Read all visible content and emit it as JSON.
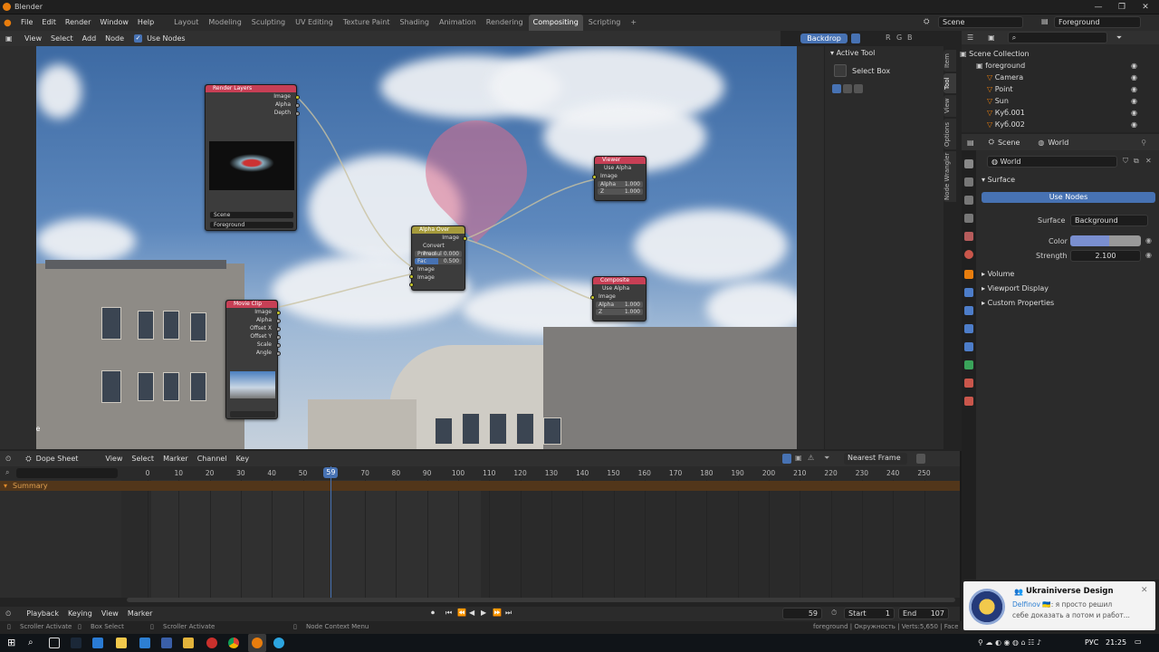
{
  "app": {
    "title": "Blender"
  },
  "menus": [
    "File",
    "Edit",
    "Render",
    "Window",
    "Help"
  ],
  "workspaces": [
    "Layout",
    "Modeling",
    "Sculpting",
    "UV Editing",
    "Texture Paint",
    "Shading",
    "Animation",
    "Rendering",
    "Compositing",
    "Scripting"
  ],
  "active_workspace": "Compositing",
  "scene_field": "Scene",
  "view_layer_field": "Foreground",
  "node_header": {
    "items": [
      "View",
      "Select",
      "Add",
      "Node"
    ],
    "use_nodes": "Use Nodes",
    "backdrop": "Backdrop",
    "channels": [
      "R",
      "G",
      "B"
    ]
  },
  "viewport": {
    "scene_label": "Scene"
  },
  "nodes": {
    "render_layers": {
      "title": "Render Layers",
      "outputs": [
        "Image",
        "Alpha",
        "Depth"
      ],
      "scene": "Scene",
      "layer": "Foreground"
    },
    "viewer": {
      "title": "Viewer",
      "use_alpha": "Use Alpha",
      "input": "Image",
      "alpha_label": "Alpha",
      "alpha_val": "1.000",
      "z_label": "Z",
      "z_val": "1.000"
    },
    "alpha_over": {
      "title": "Alpha Over",
      "output": "Image",
      "convert": "Convert Premul",
      "premul_label": "Premul",
      "premul_val": "0.000",
      "fac_label": "Fac",
      "fac_val": "0.500",
      "in1": "Image",
      "in2": "Image"
    },
    "composite": {
      "title": "Composite",
      "use_alpha": "Use Alpha",
      "input": "Image",
      "alpha_label": "Alpha",
      "alpha_val": "1.000",
      "z_label": "Z",
      "z_val": "1.000"
    },
    "movie_clip": {
      "title": "Movie Clip",
      "outputs": [
        "Image",
        "Alpha",
        "Offset X",
        "Offset Y",
        "Scale",
        "Angle"
      ]
    }
  },
  "tool_panel": {
    "title": "Active Tool",
    "tool": "Select Box"
  },
  "side_tabs": [
    "Item",
    "Tool",
    "View",
    "Options",
    "Node Wrangler"
  ],
  "outliner": {
    "root": "Scene Collection",
    "items": [
      {
        "name": "foreground",
        "depth": 1
      },
      {
        "name": "Camera",
        "depth": 2
      },
      {
        "name": "Point",
        "depth": 2
      },
      {
        "name": "Sun",
        "depth": 2
      },
      {
        "name": "Куб.001",
        "depth": 2
      },
      {
        "name": "Куб.002",
        "depth": 2
      }
    ]
  },
  "properties": {
    "breadcrumb_scene": "Scene",
    "breadcrumb_world": "World",
    "world_name": "World",
    "surface_section": "Surface",
    "use_nodes_btn": "Use Nodes",
    "surface_label": "Surface",
    "surface_value": "Background",
    "color_label": "Color",
    "strength_label": "Strength",
    "strength_value": "2.100",
    "collapsed": [
      "Volume",
      "Viewport Display",
      "Custom Properties"
    ]
  },
  "dopesheet": {
    "mode": "Dope Sheet",
    "menus": [
      "View",
      "Select",
      "Marker",
      "Channel",
      "Key"
    ],
    "snap": "Nearest Frame",
    "summary": "Summary",
    "ticks": [
      "0",
      "10",
      "20",
      "30",
      "40",
      "50",
      "59",
      "70",
      "80",
      "90",
      "100",
      "110",
      "120",
      "130",
      "140",
      "150",
      "160",
      "170",
      "180",
      "190",
      "200",
      "210",
      "220",
      "230",
      "240",
      "250"
    ],
    "current_frame": 59
  },
  "playback": {
    "menus": [
      "Playback",
      "Keying",
      "View",
      "Marker"
    ],
    "frame": "59",
    "start_label": "Start",
    "start": "1",
    "end_label": "End",
    "end": "107"
  },
  "status": {
    "left1": "Scroller Activate",
    "left2": "Box Select",
    "left3": "Scroller Activate",
    "mid": "Node Context Menu",
    "right": "foreground | Окружность | Verts:5,650 | Faces:5"
  },
  "toast": {
    "app": "Ukrainiverse Design",
    "sender": "Delfinov",
    "flag": "🇺🇦",
    "msg1": "я просто решил",
    "msg2": "себе доказать а потом и работ..."
  },
  "taskbar": {
    "lang": "РУС",
    "time": "21:25"
  },
  "colors": {
    "accent": "#4772b3",
    "header_active": "#4a4a4a",
    "summary": "#52361a"
  }
}
